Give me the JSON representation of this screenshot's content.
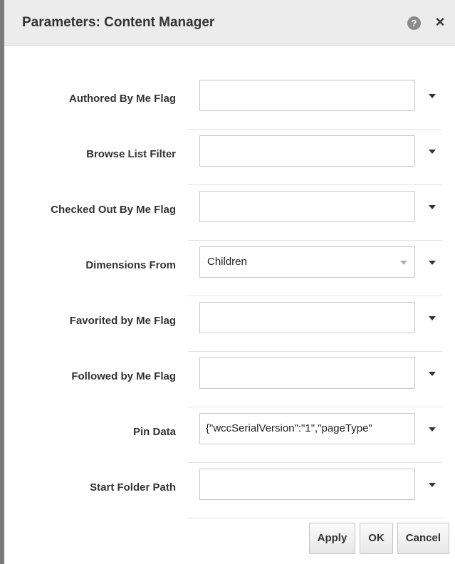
{
  "dialog": {
    "title": "Parameters: Content Manager",
    "help_icon": "?",
    "close_icon": "×"
  },
  "parameters": [
    {
      "label": "Authored By Me Flag",
      "value": ""
    },
    {
      "label": "Browse List Filter",
      "value": ""
    },
    {
      "label": "Checked Out By Me Flag",
      "value": ""
    },
    {
      "label": "Dimensions From",
      "value": "Children"
    },
    {
      "label": "Favorited by Me Flag",
      "value": ""
    },
    {
      "label": "Followed by Me Flag",
      "value": ""
    },
    {
      "label": "Pin Data",
      "value": "{\"wccSerialVersion\":\"1\",\"pageType\""
    },
    {
      "label": "Start Folder Path",
      "value": ""
    }
  ],
  "buttons": {
    "apply": "Apply",
    "ok": "OK",
    "cancel": "Cancel"
  },
  "colors": {
    "titlebar_bg": "#ececec",
    "border": "#c8c8c8",
    "text": "#333333"
  }
}
